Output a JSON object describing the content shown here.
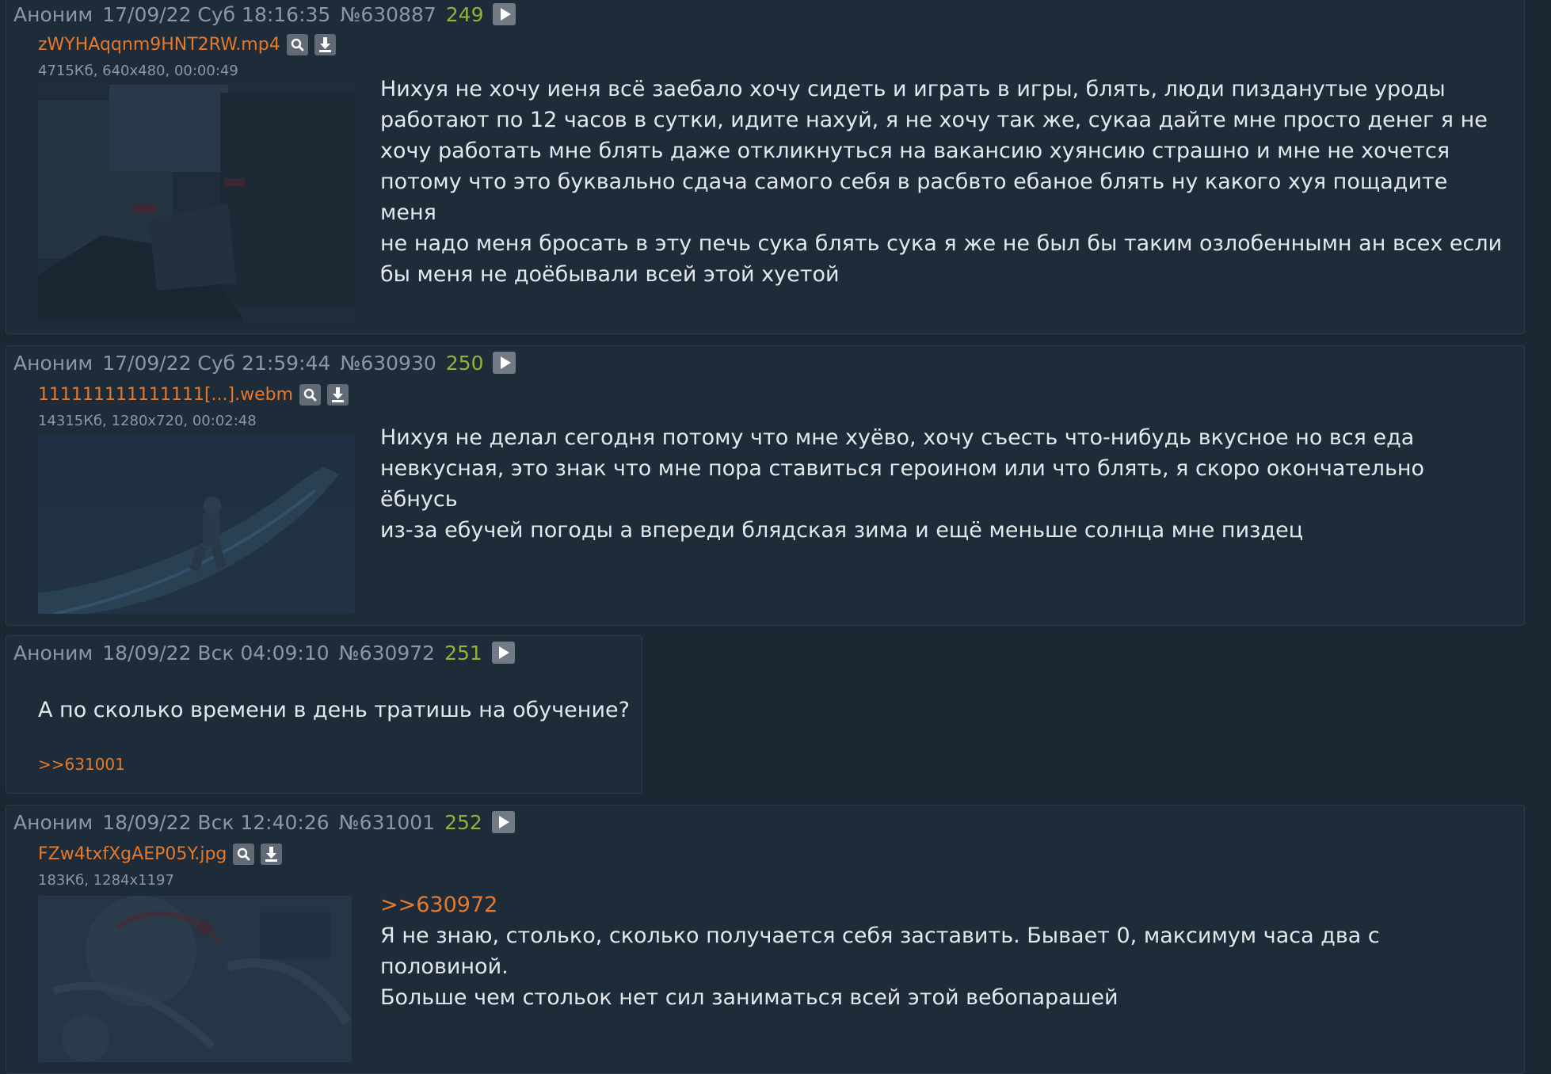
{
  "posts": [
    {
      "author": "Аноним",
      "date": "17/09/22 Суб 18:16:35",
      "id": "№630887",
      "number": "249",
      "file": {
        "name": "zWYHAqqnm9HNT2RW.mp4",
        "meta": "4715Кб, 640x480, 00:00:49"
      },
      "lines": [
        "Нихуя не хочу иеня всё заебало хочу сидеть и играть в игры, блять, люди пизданутые уроды",
        "работают по 12 часов в сутки, идите нахуй, я не хочу так же, сукаа дайте мне просто денег я не",
        "хочу работать мне блять даже откликнуться на вакансию хуянсию страшно и мне не хочется",
        "потому что это буквально сдача самого себя в расбвто ебаное блять ну какого хуя пощадите меня",
        "не надо меня бросать в эту печь сука блять сука я же не был бы таким озлобеннымн ан всех если",
        "бы меня не доёбывали всей этой хуетой"
      ]
    },
    {
      "author": "Аноним",
      "date": "17/09/22 Суб 21:59:44",
      "id": "№630930",
      "number": "250",
      "file": {
        "name": "111111111111111[...].webm",
        "meta": "14315Кб, 1280x720, 00:02:48"
      },
      "lines": [
        "Нихуя не делал сегодня потому что мне хуёво, хочу съесть что-нибудь вкусное но вся еда",
        "невкусная, это знак что мне пора ставиться героином или что блять, я скоро окончательно ёбнусь",
        "из-за ебучей погоды а впереди блядская зима и ещё меньше солнца мне пиздец"
      ]
    },
    {
      "author": "Аноним",
      "date": "18/09/22 Вск 04:09:10",
      "id": "№630972",
      "number": "251",
      "text": "А по сколько времени в день тратишь на обучение?",
      "reply": ">>631001"
    },
    {
      "author": "Аноним",
      "date": "18/09/22 Вск 12:40:26",
      "id": "№631001",
      "number": "252",
      "file": {
        "name": "FZw4txfXgAEP05Y.jpg",
        "meta": "183Кб, 1284x1197"
      },
      "quote": ">>630972",
      "lines": [
        "Я не знаю, столько, сколько получается себя заставить. Бывает 0, максимум часа два с половиной.",
        "Больше чем стольок нет сил заниматься всей этой вебопарашей"
      ]
    }
  ],
  "icons": {
    "play": "play-icon",
    "search": "search-icon",
    "download": "download-icon"
  },
  "colors": {
    "background": "#1c2734",
    "post_background": "#1e2b39",
    "border": "#2c3a49",
    "meta_text": "#8b97a4",
    "post_number": "#8fb535",
    "link": "#e7792b",
    "body_text": "#e3e8ec"
  }
}
